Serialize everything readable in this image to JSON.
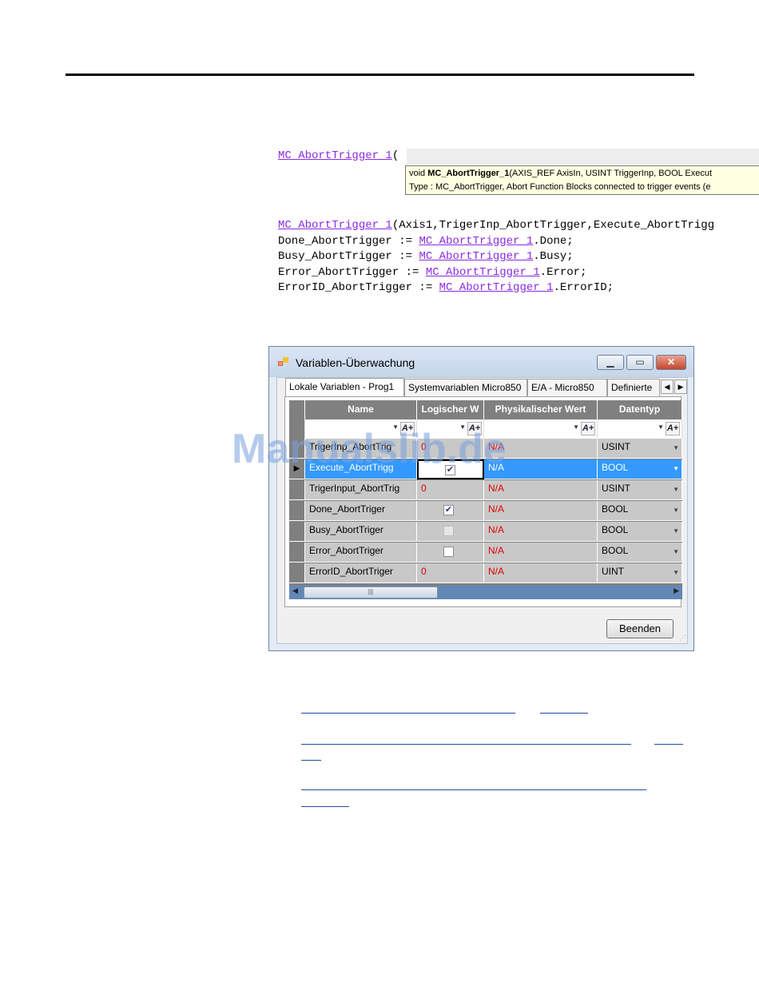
{
  "code": {
    "call_line_1": "MC_AbortTrigger_1",
    "call_line_1_paren": "(",
    "tooltip": {
      "line1_prefix": "void ",
      "line1_name": "MC_AbortTrigger_1",
      "line1_rest": "(AXIS_REF AxisIn, USINT TriggerInp, BOOL Execut",
      "line2": "Type : MC_AbortTrigger, Abort Function Blocks connected to trigger events (e"
    },
    "block": {
      "l1_fn": "MC_AbortTrigger_1",
      "l1_rest": "(Axis1,TrigerInp_AbortTrigger,Execute_AbortTrigg",
      "l2_a": "Done_AbortTrigger := ",
      "l2_fn": "MC_AbortTrigger_1",
      "l2_b": ".Done;",
      "l3_a": "Busy_AbortTrigger := ",
      "l3_fn": "MC_AbortTrigger_1",
      "l3_b": ".Busy;",
      "l4_a": "Error_AbortTrigger := ",
      "l4_fn": "MC_AbortTrigger_1",
      "l4_b": ".Error;",
      "l5_a": "ErrorID_AbortTrigger := ",
      "l5_fn": "MC_AbortTrigger_1",
      "l5_b": ".ErrorID;"
    }
  },
  "window": {
    "title": "Variablen-Überwachung",
    "minimize": "▁",
    "maximize": "▭",
    "close": "✕",
    "tabs": [
      "Lokale Variablen - Prog1",
      "Systemvariablen Micro850",
      "E/A - Micro850",
      "Definierte"
    ],
    "tab_left_arrow": "◀",
    "tab_right_arrow": "▶",
    "columns": [
      "Name",
      "Logischer W",
      "Physikalischer Wert",
      "Datentyp"
    ],
    "filter_arrow": "▼",
    "filter_btn": "A+",
    "rows": [
      {
        "name": "TrigerInp_AbortTrig",
        "logical": "0",
        "physical": "N/A",
        "type": "USINT",
        "checkbox": "none"
      },
      {
        "name": "Execute_AbortTrigg",
        "logical": "",
        "physical": "N/A",
        "type": "BOOL",
        "checkbox": "checked"
      },
      {
        "name": "TrigerInput_AbortTrig",
        "logical": "0",
        "physical": "N/A",
        "type": "USINT",
        "checkbox": "none"
      },
      {
        "name": "Done_AbortTriger",
        "logical": "",
        "physical": "N/A",
        "type": "BOOL",
        "checkbox": "checked"
      },
      {
        "name": "Busy_AbortTriger",
        "logical": "",
        "physical": "N/A",
        "type": "BOOL",
        "checkbox": "dim"
      },
      {
        "name": "Error_AbortTriger",
        "logical": "",
        "physical": "N/A",
        "type": "BOOL",
        "checkbox": "unchecked"
      },
      {
        "name": "ErrorID_AbortTriger",
        "logical": "0",
        "physical": "N/A",
        "type": "UINT",
        "checkbox": "none"
      }
    ],
    "selected_row_marker": "▶",
    "checkmark": "✔",
    "dropdown_arrow": "▼",
    "scroll_left": "◀",
    "scroll_right": "▶",
    "scroll_grip": "|||",
    "close_button": "Beenden",
    "resize_grip": "⋰"
  },
  "watermark": "Manualslib.de"
}
